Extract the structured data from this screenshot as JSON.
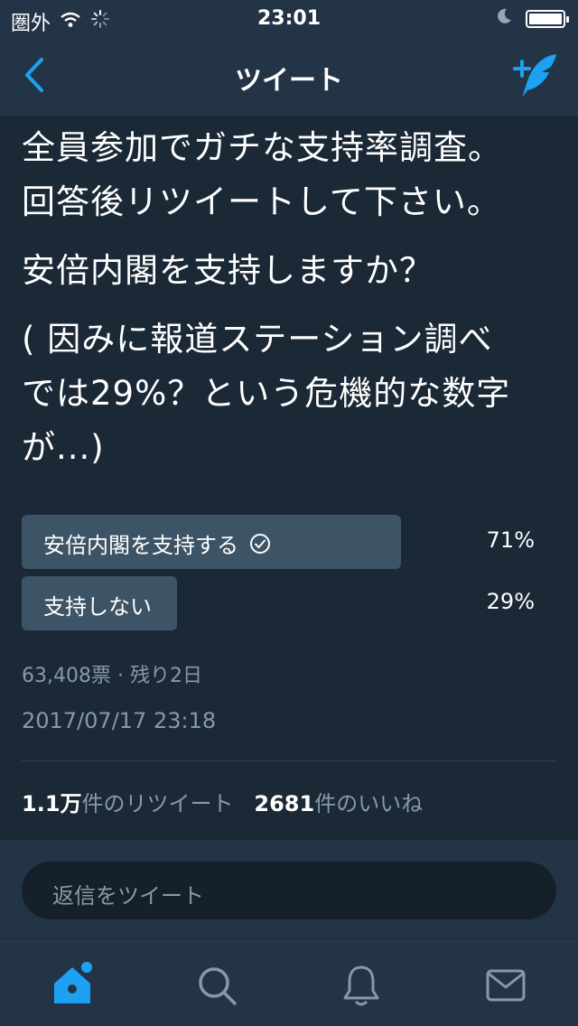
{
  "status_bar": {
    "carrier": "圏外",
    "time": "23:01"
  },
  "nav": {
    "title": "ツイート"
  },
  "tweet": {
    "lines": [
      "全員参加でガチな支持率調査。",
      "回答後リツイートして下さい。",
      "安倍内閣を支持しますか？",
      "( 因みに報道ステーション調べ",
      "では29%？という危機的な数字",
      "が...)"
    ]
  },
  "poll": {
    "options": [
      {
        "label": "安倍内閣を支持する",
        "percent": "71%",
        "share": 0.71,
        "voted": true
      },
      {
        "label": "支持しない",
        "percent": "29%",
        "share": 0.29,
        "voted": false
      }
    ],
    "meta": "63,408票 · 残り2日"
  },
  "timestamp": "2017/07/17 23:18",
  "stats": {
    "retweet_count": "1.1万",
    "retweet_label": "件のリツイート",
    "like_count": "2681",
    "like_label": "件のいいね"
  },
  "reply": {
    "placeholder": "返信をツイート"
  },
  "colors": {
    "accent": "#1da1f2",
    "background": "#1b2836",
    "bar": "#243447",
    "poll_bar": "#3d5466",
    "muted": "#8899a6"
  },
  "tabs": [
    {
      "icon": "home-icon",
      "active": true
    },
    {
      "icon": "search-icon",
      "active": false
    },
    {
      "icon": "notifications-icon",
      "active": false
    },
    {
      "icon": "messages-icon",
      "active": false
    }
  ]
}
